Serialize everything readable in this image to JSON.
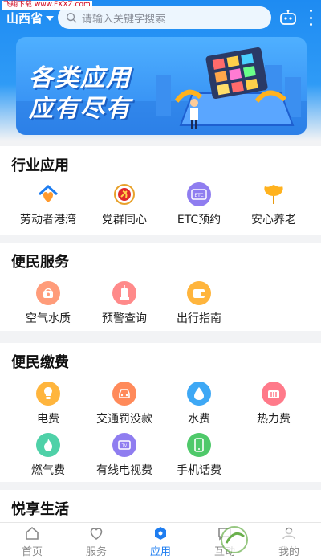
{
  "watermark": {
    "top_left": "飞翔下载 www.FXXZ.com"
  },
  "header": {
    "region": "山西省",
    "search_placeholder": "请输入关键字搜索"
  },
  "banner": {
    "line1": "各类应用",
    "line2": "应有尽有"
  },
  "sections": [
    {
      "title": "行业应用",
      "items": [
        {
          "label": "劳动者港湾",
          "icon": "heart-home-icon"
        },
        {
          "label": "党群同心",
          "icon": "party-emblem-icon"
        },
        {
          "label": "ETC预约",
          "icon": "etc-card-icon"
        },
        {
          "label": "安心养老",
          "icon": "ginkgo-leaf-icon"
        }
      ]
    },
    {
      "title": "便民服务",
      "items": [
        {
          "label": "空气水质",
          "icon": "air-quality-icon"
        },
        {
          "label": "预警查询",
          "icon": "alert-icon"
        },
        {
          "label": "出行指南",
          "icon": "travel-guide-icon"
        }
      ]
    },
    {
      "title": "便民缴费",
      "items": [
        {
          "label": "电费",
          "icon": "electricity-icon"
        },
        {
          "label": "交通罚没款",
          "icon": "traffic-fine-icon"
        },
        {
          "label": "水费",
          "icon": "water-drop-icon"
        },
        {
          "label": "热力费",
          "icon": "heating-icon"
        },
        {
          "label": "燃气费",
          "icon": "gas-flame-icon"
        },
        {
          "label": "有线电视费",
          "icon": "tv-icon"
        },
        {
          "label": "手机话费",
          "icon": "mobile-phone-icon"
        }
      ]
    },
    {
      "title": "悦享生活",
      "items": []
    }
  ],
  "nav": [
    {
      "label": "首页",
      "icon": "home-icon",
      "active": false
    },
    {
      "label": "服务",
      "icon": "heart-icon",
      "active": false
    },
    {
      "label": "应用",
      "icon": "apps-icon",
      "active": true
    },
    {
      "label": "互动",
      "icon": "chat-icon",
      "active": false
    },
    {
      "label": "我的",
      "icon": "user-icon",
      "active": false
    }
  ],
  "colors": {
    "primary": "#1e7df0",
    "header": "#2f9bf6"
  }
}
